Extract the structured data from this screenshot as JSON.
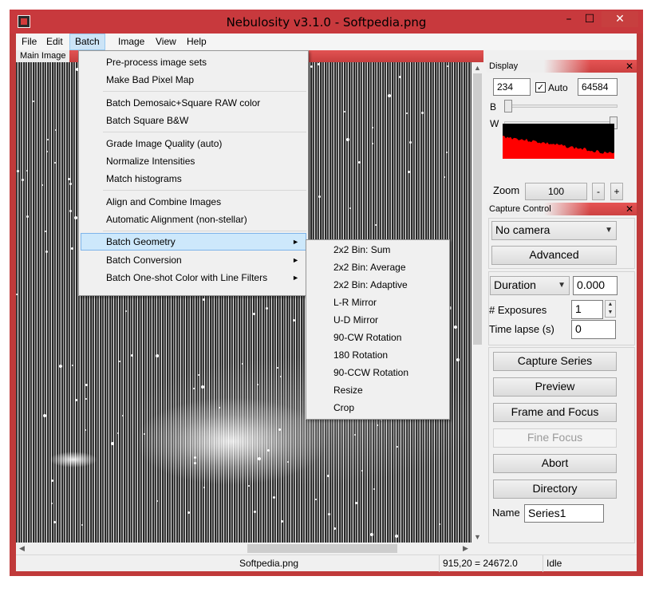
{
  "window": {
    "title": "Nebulosity v3.1.0 - Softpedia.png",
    "minimize": "–",
    "maximize": "☐",
    "close": "✕"
  },
  "menubar": {
    "items": [
      "File",
      "Edit",
      "Batch",
      "Image",
      "View",
      "Help"
    ],
    "active": "Batch"
  },
  "main_panel": {
    "label": "Main Image"
  },
  "batch_menu": {
    "items": [
      "Pre-process image sets",
      "Make Bad Pixel Map",
      "Batch Demosaic+Square RAW color",
      "Batch Square B&W",
      "Grade Image Quality (auto)",
      "Normalize Intensities",
      "Match histograms",
      "Align and Combine Images",
      "Automatic Alignment (non-stellar)",
      "Batch Geometry",
      "Batch Conversion",
      "Batch One-shot Color with Line Filters"
    ],
    "highlighted": "Batch Geometry",
    "submenu_arrow": "►"
  },
  "geometry_submenu": {
    "items": [
      "2x2 Bin: Sum",
      "2x2 Bin: Average",
      "2x2 Bin: Adaptive",
      "L-R Mirror",
      "U-D Mirror",
      "90-CW Rotation",
      "180 Rotation",
      "90-CCW Rotation",
      "Resize",
      "Crop"
    ]
  },
  "display_panel": {
    "title": "Display",
    "close": "✕",
    "black_value": "234",
    "auto_label": "Auto",
    "auto_checked": true,
    "auto_check": "✓",
    "white_value": "64584",
    "b_label": "B",
    "w_label": "W",
    "zoom_label": "Zoom",
    "zoom_value": "100",
    "zoom_minus": "-",
    "zoom_plus": "+",
    "histogram_color": "#ff0000"
  },
  "capture_panel": {
    "title": "Capture Control",
    "close": "✕",
    "camera": "No camera",
    "advanced_label": "Advanced",
    "duration_label": "Duration",
    "duration_value": "0.000",
    "exposures_label": "# Exposures",
    "exposures_value": "1",
    "timelapse_label": "Time lapse (s)",
    "timelapse_value": "0",
    "buttons": [
      "Capture Series",
      "Preview",
      "Frame and Focus",
      "Fine Focus",
      "Abort",
      "Directory"
    ],
    "name_label": "Name",
    "name_value": "Series1"
  },
  "statusbar": {
    "filename": "Softpedia.png",
    "coords": "915,20 = 24672.0",
    "state": "Idle"
  },
  "colors": {
    "title_bar": "#c8393d",
    "panel_header": "#e65454",
    "highlight": "#cde8fb"
  }
}
